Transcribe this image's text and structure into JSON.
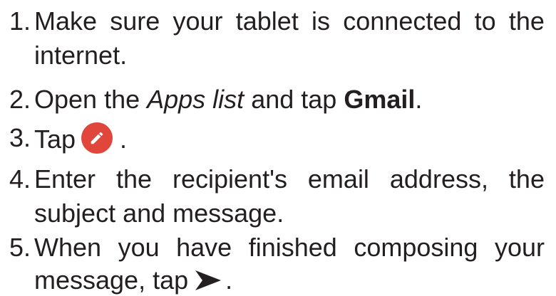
{
  "steps": [
    {
      "num": "1.",
      "line1": [
        "Make",
        "sure",
        "your",
        "tablet",
        "is",
        "connected",
        "to",
        "the"
      ],
      "line2": "internet."
    },
    {
      "num": "2.",
      "pre": "Open the ",
      "em": "Apps list",
      "mid": " and tap ",
      "strong": "Gmail",
      "post": "."
    },
    {
      "num": "3.",
      "pre": "Tap",
      "icon": "compose-pencil-icon",
      "post": "."
    },
    {
      "num": "4.",
      "line1": [
        "Enter",
        "the",
        "recipient's",
        "email",
        "address,",
        "the"
      ],
      "line2": "subject and message."
    },
    {
      "num": "5.",
      "line1": [
        "When",
        "you",
        "have",
        "finished",
        "composing",
        "your"
      ],
      "line2_pre": "message, tap",
      "icon": "send-arrow-icon",
      "line2_post": "."
    }
  ],
  "colors": {
    "text": "#231f20",
    "compose_button": "#e0463c",
    "icon_white": "#ffffff"
  }
}
